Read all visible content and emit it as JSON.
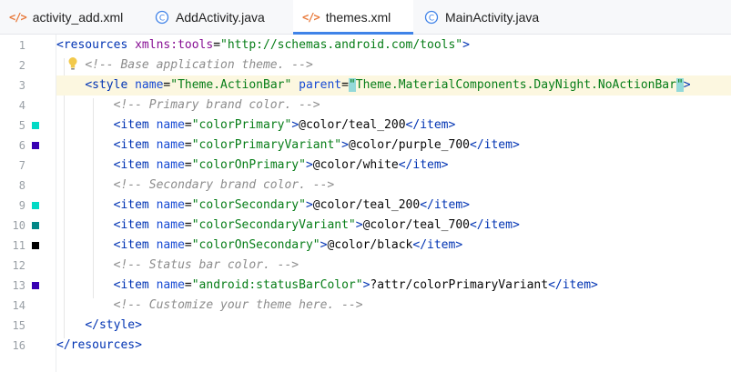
{
  "tabs": [
    {
      "label": "activity_add.xml",
      "icon": "xml-file-icon",
      "active": false
    },
    {
      "label": "AddActivity.java",
      "icon": "java-class-icon",
      "active": false
    },
    {
      "label": "themes.xml",
      "icon": "xml-file-icon",
      "active": true
    },
    {
      "label": "MainActivity.java",
      "icon": "java-class-icon",
      "active": false
    }
  ],
  "icons": {
    "xml_glyph": "</>",
    "java_glyph": "C"
  },
  "gutter": {
    "line_numbers": [
      "1",
      "2",
      "3",
      "4",
      "5",
      "6",
      "7",
      "8",
      "9",
      "10",
      "11",
      "12",
      "13",
      "14",
      "15",
      "16"
    ],
    "swatches": [
      {
        "line": 5,
        "color": "#03dac5"
      },
      {
        "line": 6,
        "color": "#3700b3"
      },
      {
        "line": 9,
        "color": "#03dac5"
      },
      {
        "line": 10,
        "color": "#018786"
      },
      {
        "line": 11,
        "color": "#000000"
      },
      {
        "line": 13,
        "color": "#3700b3"
      }
    ]
  },
  "code": {
    "l1": {
      "open": "<resources",
      "attr": "xmlns:tools",
      "eq": "=",
      "val": "\"http://schemas.android.com/tools\"",
      "close": ">"
    },
    "l2": {
      "comment": "<!-- Base application theme. -->"
    },
    "l3": {
      "open": "<style",
      "attr1": "name",
      "eq1": "=",
      "val1": "\"Theme.ActionBar\"",
      "attr2": "parent",
      "eq2": "=",
      "q1": "\"",
      "val2": "Theme.MaterialComponents.DayNight.NoActionBar",
      "q2": "\"",
      "close": ">"
    },
    "l4": {
      "comment": "<!-- Primary brand color. -->"
    },
    "l5": {
      "open": "<item",
      "attr": "name",
      "eq": "=",
      "val": "\"colorPrimary\"",
      "gt": ">",
      "text": "@color/teal_200",
      "close": "</item>"
    },
    "l6": {
      "open": "<item",
      "attr": "name",
      "eq": "=",
      "val": "\"colorPrimaryVariant\"",
      "gt": ">",
      "text": "@color/purple_700",
      "close": "</item>"
    },
    "l7": {
      "open": "<item",
      "attr": "name",
      "eq": "=",
      "val": "\"colorOnPrimary\"",
      "gt": ">",
      "text": "@color/white",
      "close": "</item>"
    },
    "l8": {
      "comment": "<!-- Secondary brand color. -->"
    },
    "l9": {
      "open": "<item",
      "attr": "name",
      "eq": "=",
      "val": "\"colorSecondary\"",
      "gt": ">",
      "text": "@color/teal_200",
      "close": "</item>"
    },
    "l10": {
      "open": "<item",
      "attr": "name",
      "eq": "=",
      "val": "\"colorSecondaryVariant\"",
      "gt": ">",
      "text": "@color/teal_700",
      "close": "</item>"
    },
    "l11": {
      "open": "<item",
      "attr": "name",
      "eq": "=",
      "val": "\"colorOnSecondary\"",
      "gt": ">",
      "text": "@color/black",
      "close": "</item>"
    },
    "l12": {
      "comment": "<!-- Status bar color. -->"
    },
    "l13": {
      "open": "<item",
      "attr": "name",
      "eq": "=",
      "val": "\"android:statusBarColor\"",
      "gt": ">",
      "text": "?attr/colorPrimaryVariant",
      "close": "</item>"
    },
    "l14": {
      "comment": "<!-- Customize your theme here. -->"
    },
    "l15": {
      "close": "</style>"
    },
    "l16": {
      "close": "</resources>"
    }
  },
  "colors": {
    "accent": "#4083e8",
    "current_line": "#fcf7e0",
    "bracket_match": "#93d9d9"
  }
}
